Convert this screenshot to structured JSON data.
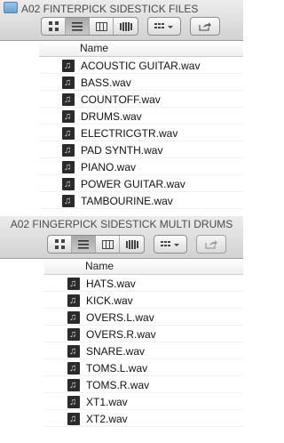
{
  "windows": [
    {
      "title": "A02 FINTERPICK SIDESTICK FILES",
      "column_header": "Name",
      "files": [
        "ACOUSTIC GUITAR.wav",
        "BASS.wav",
        "COUNTOFF.wav",
        "DRUMS.wav",
        "ELECTRICGTR.wav",
        "PAD SYNTH.wav",
        "PIANO.wav",
        "POWER GUITAR.wav",
        "TAMBOURINE.wav"
      ]
    },
    {
      "title": "A02 FINGERPICK SIDESTICK MULTI DRUMS",
      "column_header": "Name",
      "files": [
        "HATS.wav",
        "KICK.wav",
        "OVERS.L.wav",
        "OVERS.R.wav",
        "SNARE.wav",
        "TOMS.L.wav",
        "TOMS.R.wav",
        "XT1.wav",
        "XT2.wav"
      ]
    }
  ],
  "toolbar": {
    "view_buttons": [
      "icon-view-icon",
      "list-view-icon",
      "column-view-icon",
      "cover-flow-icon"
    ],
    "active_view": 1,
    "arrange_icon": "arrange-menu-icon",
    "share_icon": "share-icon"
  },
  "file_icon": "audio-file-icon",
  "file_icon_glyph": "♫"
}
